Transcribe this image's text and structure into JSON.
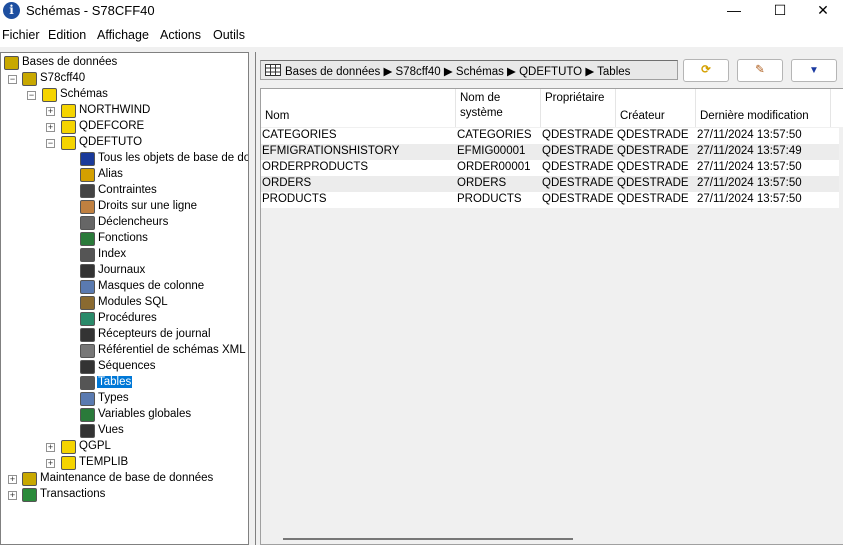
{
  "window": {
    "title": "Schémas - S78CFF40",
    "app_icon": "i",
    "minimize": "—",
    "maximize": "☐",
    "close": "✕"
  },
  "menu": [
    "Fichier",
    "Edition",
    "Affichage",
    "Actions",
    "Outils"
  ],
  "tree": [
    {
      "label": "Bases de données",
      "level": 0,
      "exp": "",
      "icon": "database-icon",
      "color": "#c8a800"
    },
    {
      "label": "S78cff40",
      "level": 1,
      "exp": "−",
      "icon": "system-icon",
      "color": "#c8a800"
    },
    {
      "label": "Schémas",
      "level": 2,
      "exp": "−",
      "icon": "folder-icon",
      "color": "#f5d400"
    },
    {
      "label": "NORTHWIND",
      "level": 3,
      "exp": "+",
      "icon": "schema-icon",
      "color": "#f5d400"
    },
    {
      "label": "QDEFCORE",
      "level": 3,
      "exp": "+",
      "icon": "schema-icon",
      "color": "#f5d400"
    },
    {
      "label": "QDEFTUTO",
      "level": 3,
      "exp": "−",
      "icon": "schema-icon",
      "color": "#f5d400"
    },
    {
      "label": "Tous les objets de base de données",
      "level": 4,
      "exp": "",
      "icon": "all-objects-icon",
      "color": "#1a3a9a"
    },
    {
      "label": "Alias",
      "level": 4,
      "exp": "",
      "icon": "alias-icon",
      "color": "#d4a000"
    },
    {
      "label": "Contraintes",
      "level": 4,
      "exp": "",
      "icon": "constraints-icon",
      "color": "#444"
    },
    {
      "label": "Droits sur une ligne",
      "level": 4,
      "exp": "",
      "icon": "row-rights-icon",
      "color": "#c08040"
    },
    {
      "label": "Déclencheurs",
      "level": 4,
      "exp": "",
      "icon": "triggers-icon",
      "color": "#666"
    },
    {
      "label": "Fonctions",
      "level": 4,
      "exp": "",
      "icon": "functions-icon",
      "color": "#2a7a3a"
    },
    {
      "label": "Index",
      "level": 4,
      "exp": "",
      "icon": "index-icon",
      "color": "#555"
    },
    {
      "label": "Journaux",
      "level": 4,
      "exp": "",
      "icon": "journals-icon",
      "color": "#333"
    },
    {
      "label": "Masques de colonne",
      "level": 4,
      "exp": "",
      "icon": "column-masks-icon",
      "color": "#5a7ab0"
    },
    {
      "label": "Modules SQL",
      "level": 4,
      "exp": "",
      "icon": "sql-modules-icon",
      "color": "#8a6a30"
    },
    {
      "label": "Procédures",
      "level": 4,
      "exp": "",
      "icon": "procedures-icon",
      "color": "#2a8a6a"
    },
    {
      "label": "Récepteurs de journal",
      "level": 4,
      "exp": "",
      "icon": "journal-receivers-icon",
      "color": "#333"
    },
    {
      "label": "Référentiel de schémas XML (XSR)",
      "level": 4,
      "exp": "",
      "icon": "xml-repository-icon",
      "color": "#777"
    },
    {
      "label": "Séquences",
      "level": 4,
      "exp": "",
      "icon": "sequences-icon",
      "color": "#333"
    },
    {
      "label": "Tables",
      "level": 4,
      "exp": "",
      "icon": "table-icon",
      "color": "#555",
      "selected": true
    },
    {
      "label": "Types",
      "level": 4,
      "exp": "",
      "icon": "types-icon",
      "color": "#5a7ab0"
    },
    {
      "label": "Variables globales",
      "level": 4,
      "exp": "",
      "icon": "global-variables-icon",
      "color": "#2a7a3a"
    },
    {
      "label": "Vues",
      "level": 4,
      "exp": "",
      "icon": "views-icon",
      "color": "#333"
    },
    {
      "label": "QGPL",
      "level": 3,
      "exp": "+",
      "icon": "schema-icon",
      "color": "#f5d400"
    },
    {
      "label": "TEMPLIB",
      "level": 3,
      "exp": "+",
      "icon": "schema-icon",
      "color": "#f5d400"
    },
    {
      "label": "Maintenance de base de données",
      "level": 1,
      "exp": "+",
      "icon": "maintenance-icon",
      "color": "#c8a800"
    },
    {
      "label": "Transactions",
      "level": 1,
      "exp": "+",
      "icon": "transactions-icon",
      "color": "#2a8a3a"
    }
  ],
  "breadcrumb": "Bases de données ▶ S78cff40 ▶ Schémas ▶ QDEFTUTO ▶ Tables",
  "toolbar": {
    "refresh": "⟳",
    "columns": "✎",
    "filter": "▼"
  },
  "table": {
    "headers": [
      "Nom",
      "Nom de système",
      "Propriétaire",
      "Créateur",
      "Dernière modification"
    ],
    "rows": [
      [
        "CATEGORIES",
        "CATEGORIES",
        "QDESTRADE",
        "QDESTRADE",
        "27/11/2024 13:57:50"
      ],
      [
        "EFMIGRATIONSHISTORY",
        "EFMIG00001",
        "QDESTRADE",
        "QDESTRADE",
        "27/11/2024 13:57:49"
      ],
      [
        "ORDERPRODUCTS",
        "ORDER00001",
        "QDESTRADE",
        "QDESTRADE",
        "27/11/2024 13:57:50"
      ],
      [
        "ORDERS",
        "ORDERS",
        "QDESTRADE",
        "QDESTRADE",
        "27/11/2024 13:57:50"
      ],
      [
        "PRODUCTS",
        "PRODUCTS",
        "QDESTRADE",
        "QDESTRADE",
        "27/11/2024 13:57:50"
      ]
    ]
  }
}
